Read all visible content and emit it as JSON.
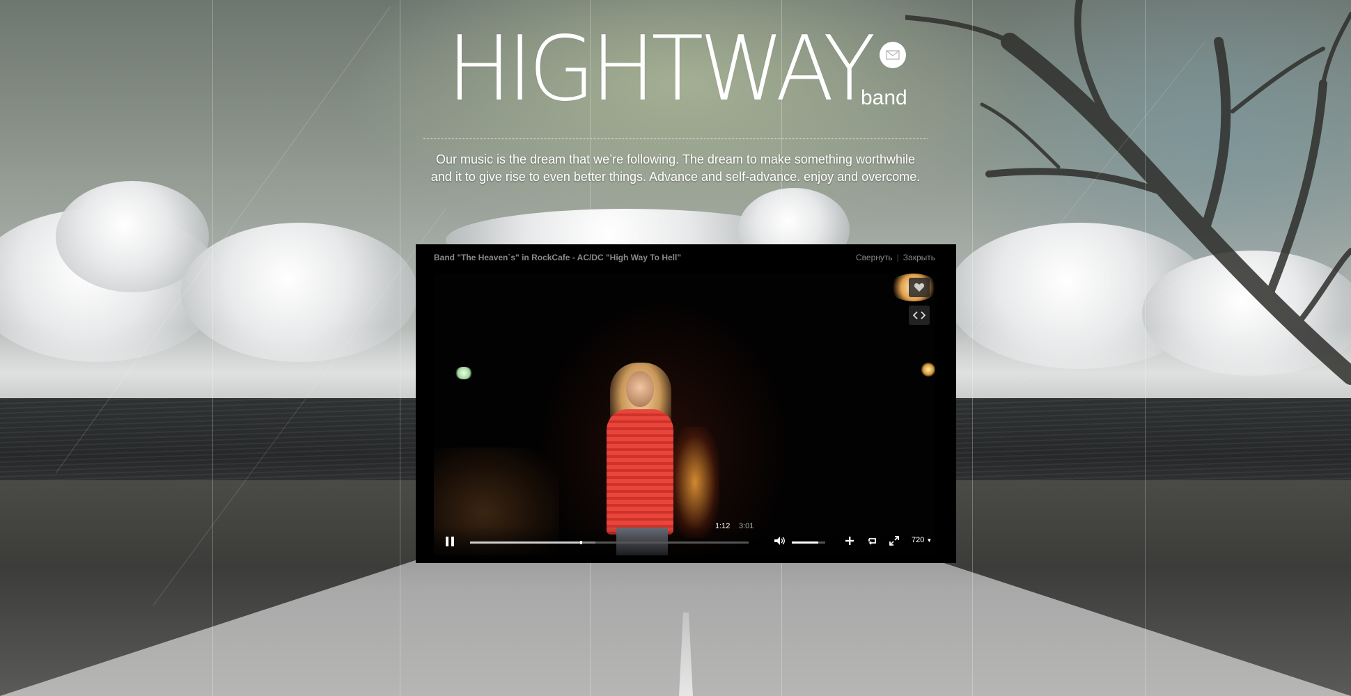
{
  "header": {
    "logo": "HIGHTWAY",
    "logo_sub": "band",
    "tagline_line1": "Our music is the dream that we’re following. The dream to make something worthwhile",
    "tagline_line2": "and it to give rise to even better things. Advance and self-advance. enjoy and overcome."
  },
  "icons": {
    "mail": "envelope-icon",
    "like": "heart-icon",
    "embed": "code-icon",
    "play_state": "pause-icon",
    "volume": "speaker-icon",
    "add": "plus-icon",
    "loop": "loop-icon",
    "fullscreen": "fullscreen-icon"
  },
  "player": {
    "title": "Band \"The Heaven`s\" in RockCafe - AC/DC \"High Way To Hell\"",
    "minimize_label": "Свернуть",
    "separator": "|",
    "close_label": "Закрыть",
    "current_time": "1:12",
    "total_time": "3:01",
    "quality": "720",
    "progress_played_fraction": 0.398,
    "progress_buffered_fraction": 0.45,
    "volume_fraction": 0.8
  },
  "colors": {
    "modal_bg": "#000000",
    "text_muted": "#8a8a8a",
    "singer_shirt": "#e8453c"
  }
}
